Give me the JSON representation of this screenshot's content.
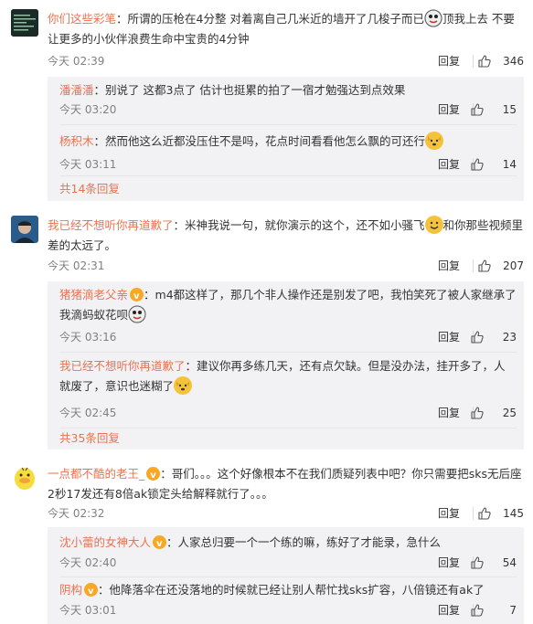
{
  "comments": [
    {
      "user": "你们这些彩笔",
      "text_a": "：所谓的压枪在4分整 对着离自己几米近的墙开了几梭子而已",
      "text_b": "顶我上去 不要让更多的小伙伴浪费生命中宝贵的4分钟",
      "time": "今天 02:39",
      "reply": "回复",
      "likes": "346",
      "replies": [
        {
          "user": "潘潘潘",
          "text": "：别说了 这都3点了 估计也挺累的拍了一宿才勉强达到点效果",
          "time": "今天 03:20",
          "reply": "回复",
          "likes": "15"
        },
        {
          "user": "杨积木",
          "text": "：然而他这么近都没压住不是吗，花点时间看看他怎么飘的可还行",
          "time": "今天 03:11",
          "reply": "回复",
          "likes": "14"
        }
      ],
      "more": "共14条回复"
    },
    {
      "user": "我已经不想听你再道歉了",
      "text_a": "：米神我说一句，就你演示的这个，还不如小骚飞",
      "text_b": "和你那些视频里差的太远了。",
      "time": "今天 02:31",
      "reply": "回复",
      "likes": "207",
      "replies": [
        {
          "user": "猪猪滴老父亲",
          "text": "：m4都这样了，那几个非人操作还是别发了吧，我怕笑死了被人家继承了我滴蚂蚁花呗",
          "time": "今天 03:16",
          "reply": "回复",
          "likes": "23"
        },
        {
          "user": "我已经不想听你再道歉了",
          "text": "：建议你再多练几天，还有点欠缺。但是没办法，挂开多了，人就废了，意识也迷糊了",
          "time": "今天 02:45",
          "reply": "回复",
          "likes": "25"
        }
      ],
      "more": "共35条回复"
    },
    {
      "user": "一点都不酷的老王_",
      "text_a": "：哥们。。。这个好像根本不在我们质疑列表中吧？你只需要把sks无后座2秒17发还有8倍ak锁定头给解释就行了。。。",
      "time": "今天 02:32",
      "reply": "回复",
      "likes": "145",
      "replies": [
        {
          "user": "沈小蕾的女神大人",
          "text": "：人家总归要一个一个练的嘛，练好了才能录，急什么",
          "time": "今天 02:40",
          "reply": "回复",
          "likes": "54"
        },
        {
          "user": "阴构",
          "text": "：他降落伞在还没落地的时候就已经让别人帮忙找sks扩容，八倍镜还有ak了",
          "time": "今天 03:01",
          "reply": "回复",
          "likes": "7"
        }
      ]
    }
  ],
  "colors": {
    "username": "#eb7350",
    "subBackground": "#f2f2f5",
    "meta": "#808080"
  }
}
